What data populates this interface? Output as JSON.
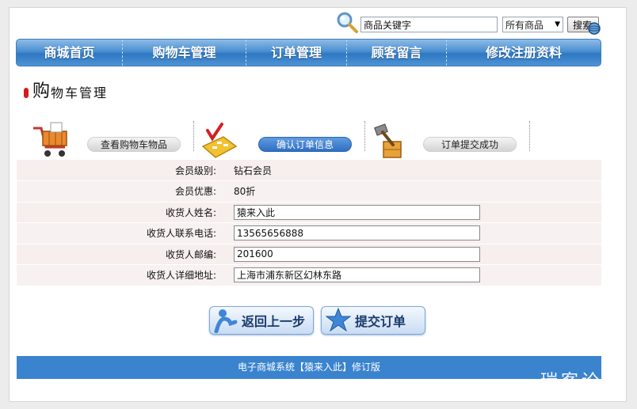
{
  "search": {
    "value": "商品关键字",
    "category_selected": "所有商品",
    "button_label": "搜索"
  },
  "nav": {
    "items": [
      {
        "label": "商城首页"
      },
      {
        "label": "购物车管理"
      },
      {
        "label": "订单管理"
      },
      {
        "label": "顾客留言"
      },
      {
        "label": "修改注册资料"
      }
    ]
  },
  "page_title": {
    "first_char": "购",
    "rest": "物车管理"
  },
  "steps": [
    {
      "label": "查看购物车物品",
      "active": false
    },
    {
      "label": "确认订单信息",
      "active": true
    },
    {
      "label": "订单提交成功",
      "active": false
    }
  ],
  "form": {
    "rows": [
      {
        "label": "会员级别:",
        "value": "钻石会员"
      },
      {
        "label": "会员优惠:",
        "value": "80折"
      },
      {
        "label": "收货人姓名:",
        "input": "猿来入此"
      },
      {
        "label": "收货人联系电话:",
        "input": "13565656888"
      },
      {
        "label": "收货人邮编:",
        "input": "201600"
      },
      {
        "label": "收货人详细地址:",
        "input": "上海市浦东新区幻林东路"
      }
    ]
  },
  "actions": {
    "back_label": "返回上一步",
    "submit_label": "提交订单"
  },
  "footer": {
    "text": "电子商城系统【猿来入此】修订版"
  },
  "watermark": {
    "text": "瑞客论坛"
  },
  "colors": {
    "nav_blue": "#4a8fd1",
    "footer_blue": "#3a83cf",
    "row_bg": "#f8f1f1",
    "bullet_red": "#d31c1c"
  }
}
